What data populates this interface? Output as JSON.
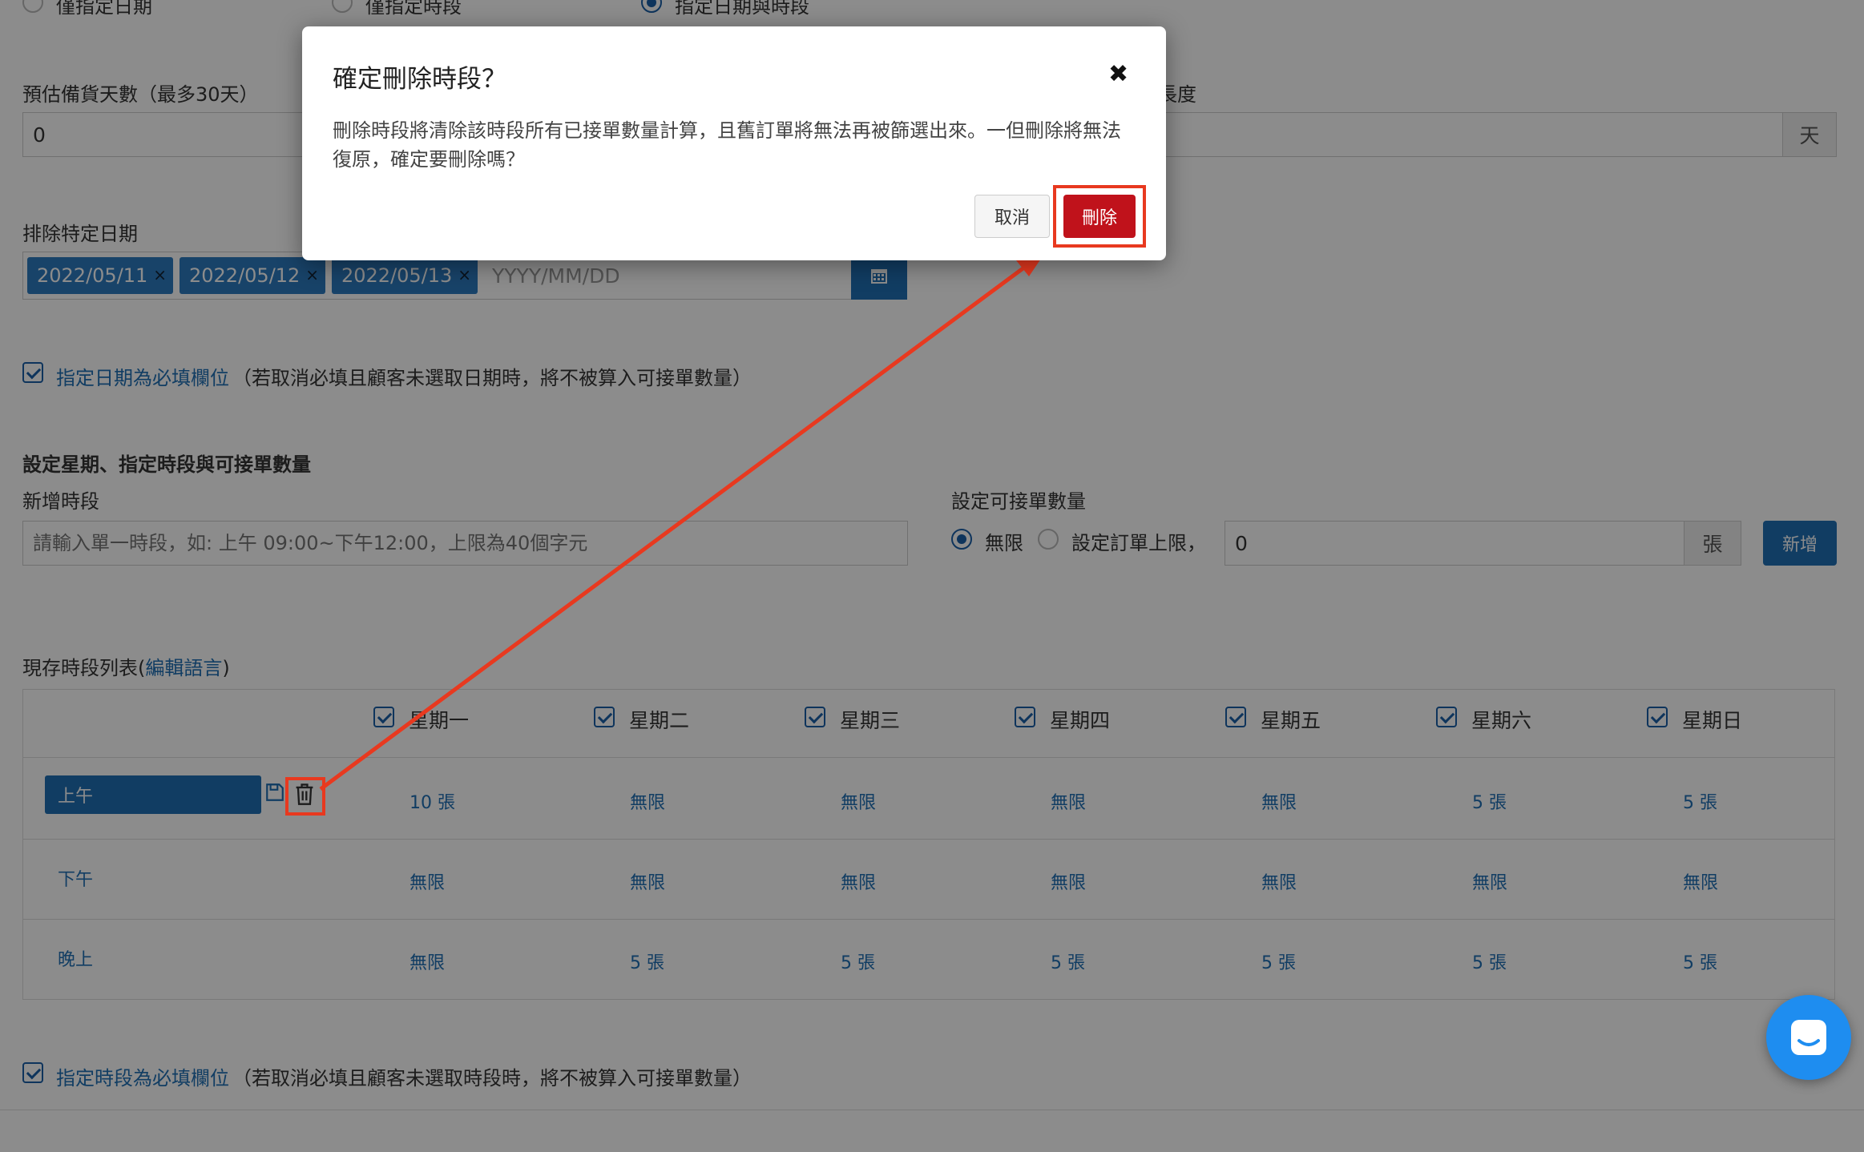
{
  "top_radios": {
    "date_only": "僅指定日期",
    "time_only": "僅指定時段",
    "date_and_time": "指定日期與時段"
  },
  "prep_days": {
    "label": "預估備貨天數（最多30天）",
    "value": "0",
    "right_label_fragment": "長度",
    "right_unit": "天"
  },
  "exclude_dates": {
    "label": "排除特定日期",
    "tags": [
      "2022/05/11",
      "2022/05/12",
      "2022/05/13"
    ],
    "remove_glyph": "×",
    "placeholder": "YYYY/MM/DD"
  },
  "date_required": {
    "label": "指定日期為必填欄位",
    "note": "（若取消必填且顧客未選取日期時，將不被算入可接單數量）"
  },
  "schedule": {
    "section_title": "設定星期、指定時段與可接單數量",
    "new_slot_label": "新增時段",
    "new_slot_placeholder": "請輸入單一時段，如: 上午 09:00~下午12:00，上限為40個字元",
    "capacity_label": "設定可接單數量",
    "unlimited": "無限",
    "set_limit": "設定訂單上限，",
    "limit_value": "0",
    "unit": "張",
    "add_button": "新增"
  },
  "slot_list": {
    "title": "現存時段列表(",
    "edit_lang": "編輯語言",
    "title_close": ")",
    "days": [
      "星期一",
      "星期二",
      "星期三",
      "星期四",
      "星期五",
      "星期六",
      "星期日"
    ],
    "rows": [
      {
        "name": "上午",
        "cells": [
          "10 張",
          "無限",
          "無限",
          "無限",
          "無限",
          "5 張",
          "5 張"
        ]
      },
      {
        "name": "下午",
        "cells": [
          "無限",
          "無限",
          "無限",
          "無限",
          "無限",
          "無限",
          "無限"
        ]
      },
      {
        "name": "晚上",
        "cells": [
          "無限",
          "5 張",
          "5 張",
          "5 張",
          "5 張",
          "5 張",
          "5 張"
        ]
      }
    ]
  },
  "time_required": {
    "label": "指定時段為必填欄位",
    "note": "（若取消必填且顧客未選取時段時，將不被算入可接單數量）"
  },
  "modal": {
    "title": "確定刪除時段？",
    "close": "✖",
    "body": "刪除時段將清除該時段所有已接單數量計算，且舊訂單將無法再被篩選出來。一但刪除將無法復原，確定要刪除嗎？",
    "cancel": "取消",
    "delete": "刪除"
  },
  "colors": {
    "accent": "#1f6fb5",
    "danger": "#c0121b",
    "highlight": "#e8391f"
  },
  "icons": {
    "calendar": "calendar-icon",
    "trash": "trash-icon",
    "save": "save-icon",
    "chat": "chat-icon"
  }
}
